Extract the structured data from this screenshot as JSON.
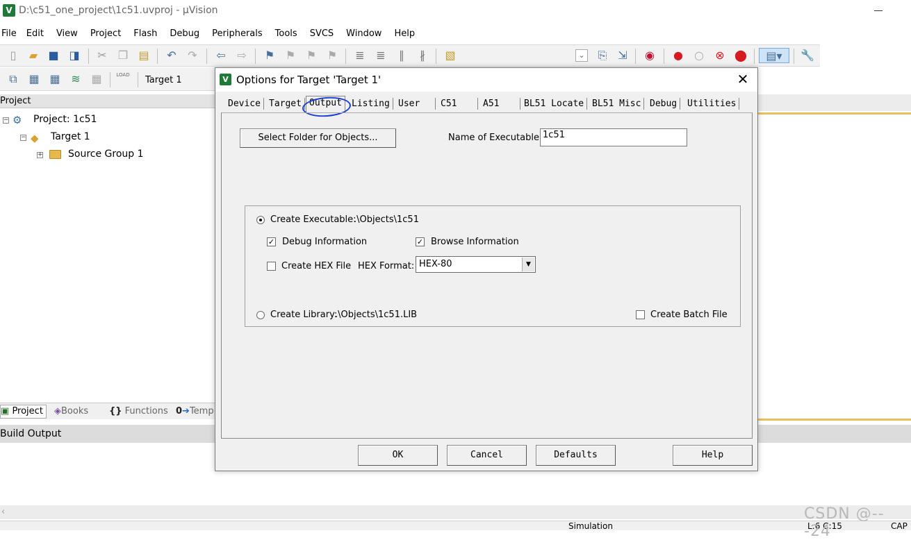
{
  "window": {
    "title": "D:\\c51_one_project\\1c51.uvproj - μVision",
    "icon_text": "V"
  },
  "menu": [
    "File",
    "Edit",
    "View",
    "Project",
    "Flash",
    "Debug",
    "Peripherals",
    "Tools",
    "SVCS",
    "Window",
    "Help"
  ],
  "toolbar2": {
    "target": "Target 1",
    "load_label": "LOAD"
  },
  "project_pane": {
    "header": "Project",
    "tree": [
      {
        "label": "Project: 1c51",
        "icon": "project-icon"
      },
      {
        "label": "Target 1",
        "icon": "target-icon"
      },
      {
        "label": "Source Group 1",
        "icon": "folder-icon"
      }
    ],
    "bottom_tabs": [
      "Project",
      "Books",
      "Functions",
      "Temp"
    ]
  },
  "build_output": {
    "header": "Build Output"
  },
  "status": {
    "mode": "Simulation",
    "position": "L:6 C:15",
    "caps": "CAP"
  },
  "watermark": "CSDN @---24",
  "dialog": {
    "title": "Options for Target 'Target 1'",
    "tabs": [
      "Device",
      "Target",
      "Output",
      "Listing",
      "User",
      "C51",
      "A51",
      "BL51 Locate",
      "BL51 Misc",
      "Debug",
      "Utilities"
    ],
    "active_tab": "Output",
    "select_folder_label": "Select Folder for Objects...",
    "name_exe_label": "Name of Executable:",
    "name_exe_value": "1c51",
    "create_exe_label": "Create Executable:",
    "create_exe_path": ".\\Objects\\1c51",
    "create_exe_selected": true,
    "debug_info_label": "Debug Information",
    "debug_info_checked": true,
    "browse_info_label": "Browse Information",
    "browse_info_checked": true,
    "create_hex_label": "Create HEX File",
    "create_hex_checked": false,
    "hex_format_label": "HEX Format:",
    "hex_format_value": "HEX-80",
    "create_lib_label": "Create Library:",
    "create_lib_path": ".\\Objects\\1c51.LIB",
    "create_lib_selected": false,
    "batch_label": "Create Batch File",
    "batch_checked": false,
    "buttons": {
      "ok": "OK",
      "cancel": "Cancel",
      "defaults": "Defaults",
      "help": "Help"
    }
  }
}
